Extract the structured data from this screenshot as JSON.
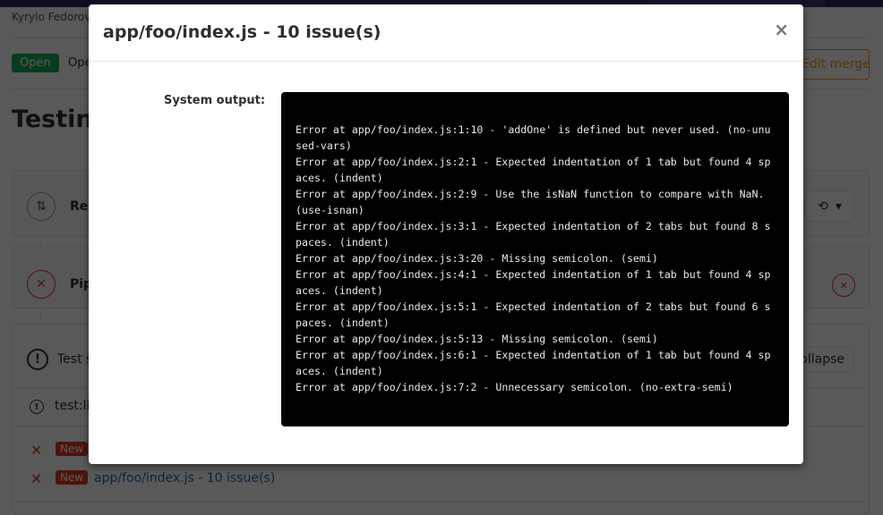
{
  "background": {
    "author": "Kyrylo Fedorov",
    "status_badge": "Open",
    "opened_text": "Opened",
    "edit_button": "Edit merge request",
    "mr_title": "Testing",
    "request_card_label": "Request",
    "pipeline_card_label": "Pipeline",
    "test_summary": "Test summary",
    "collapse_button": "Collapse",
    "test_suite_name": "test:lint",
    "issues": [
      {
        "badge": "New",
        "label": ""
      },
      {
        "badge": "New",
        "label": "app/foo/index.js - 10 issue(s)"
      }
    ]
  },
  "modal": {
    "title": "app/foo/index.js - 10 issue(s)",
    "close_icon": "×",
    "system_output_label": "System output:",
    "system_output_lines": [
      "Error at app/foo/index.js:1:10 - 'addOne' is defined but never used. (no-unused-vars)",
      "Error at app/foo/index.js:2:1 - Expected indentation of 1 tab but found 4 spaces. (indent)",
      "Error at app/foo/index.js:2:9 - Use the isNaN function to compare with NaN. (use-isnan)",
      "Error at app/foo/index.js:3:1 - Expected indentation of 2 tabs but found 8 spaces. (indent)",
      "Error at app/foo/index.js:3:20 - Missing semicolon. (semi)",
      "Error at app/foo/index.js:4:1 - Expected indentation of 1 tab but found 4 spaces. (indent)",
      "Error at app/foo/index.js:5:1 - Expected indentation of 2 tabs but found 6 spaces. (indent)",
      "Error at app/foo/index.js:5:13 - Missing semicolon. (semi)",
      "Error at app/foo/index.js:6:1 - Expected indentation of 1 tab but found 4 spaces. (indent)",
      "Error at app/foo/index.js:7:2 - Unnecessary semicolon. (no-extra-semi)"
    ]
  },
  "colors": {
    "success": "#1aaa55",
    "danger": "#db3b21",
    "warning": "#fc9403",
    "link": "#1b69b6",
    "nav": "#292961"
  }
}
